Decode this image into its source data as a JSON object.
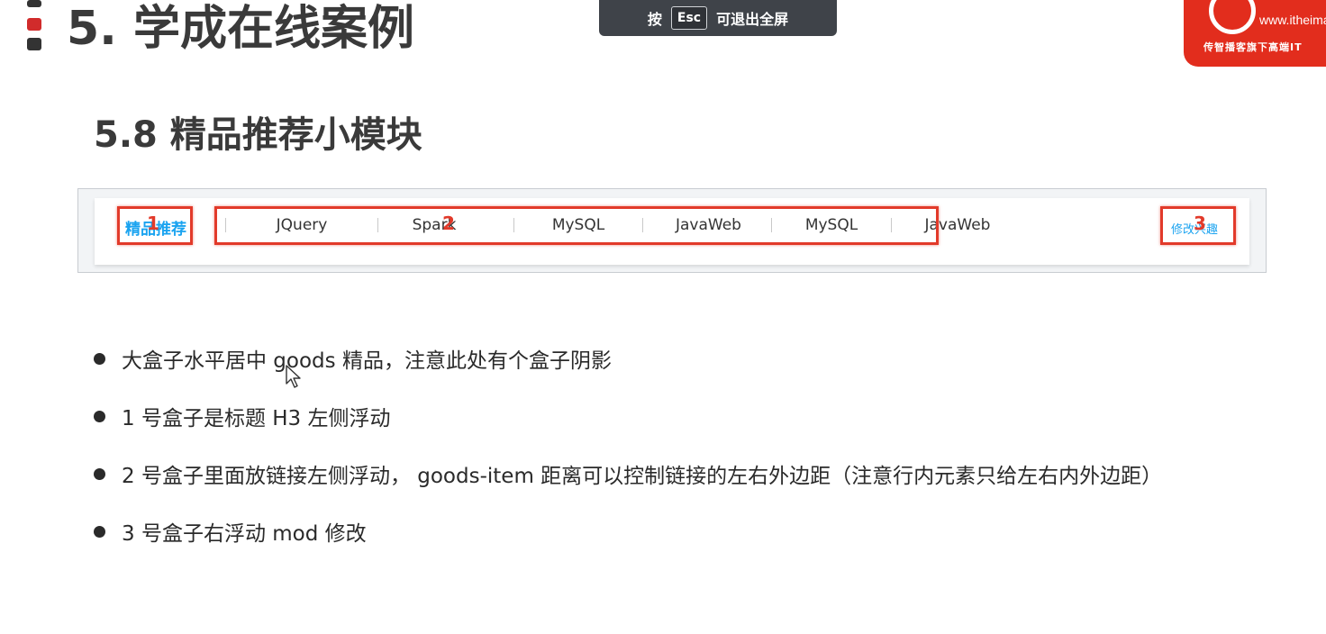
{
  "slide": {
    "title": "5. 学成在线案例",
    "section_title": "5.8 精品推荐小模块"
  },
  "esc_overlay": {
    "prefix": "按",
    "key": "Esc",
    "suffix": "可退出全屏"
  },
  "logo": {
    "site": "www.itheima",
    "tagline": "传智播客旗下高端IT"
  },
  "demo": {
    "title": "精品推荐",
    "numbers": [
      "1",
      "2",
      "3"
    ],
    "nav_items": [
      "JQuery",
      "Spark",
      "MySQL",
      "JavaWeb",
      "MySQL",
      "JavaWeb"
    ],
    "mod_link": "修改兴趣",
    "box_color": "#e23a2a",
    "link_color": "#1aa3f0"
  },
  "bullets": [
    "大盒子水平居中 goods  精品，注意此处有个盒子阴影",
    "1 号盒子是标题 H3 左侧浮动",
    "2 号盒子里面放链接左侧浮动， goods-item 距离可以控制链接的左右外边距（注意行内元素只给左右内外边距）",
    "3 号盒子右浮动 mod 修改"
  ]
}
